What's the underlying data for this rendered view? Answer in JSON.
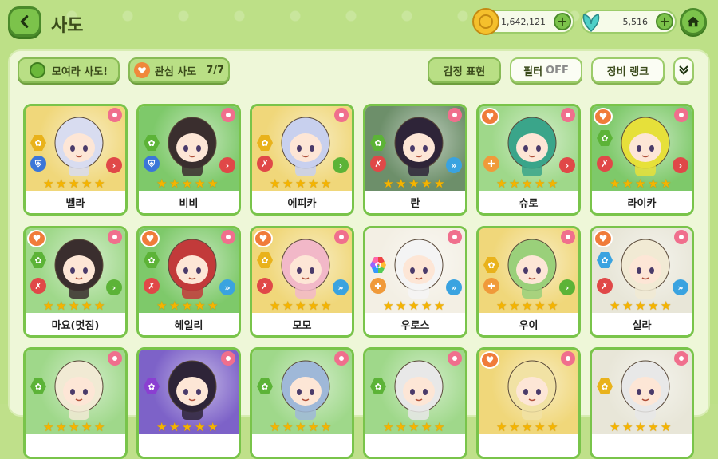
{
  "header": {
    "title": "사도",
    "currency_gold": "1,642,121",
    "currency_leaf": "5,516"
  },
  "toolbar": {
    "gather_label": "모여라 사도!",
    "favorite_label": "관심 사도",
    "favorite_count": "7/7",
    "emote_label": "감정 표현",
    "filter_label": "필터",
    "filter_state": "OFF",
    "rank_label": "장비 랭크"
  },
  "colors": {
    "accent_green": "#79c44a",
    "background": "#bde087",
    "star": "#f5b400",
    "fav_heart": "#f07c3a",
    "flower": "#f06f8d"
  },
  "characters": [
    {
      "name": "벨라",
      "stars": 5,
      "favorite": false,
      "element": "yellow",
      "class": "shield",
      "bg": "#f0d77a",
      "hair": "#d8dcf0",
      "arrow": "red"
    },
    {
      "name": "비비",
      "stars": 5,
      "favorite": false,
      "element": "green",
      "class": "shield",
      "bg": "#7ec96a",
      "hair": "#3a2e2e",
      "arrow": "red"
    },
    {
      "name": "에피카",
      "stars": 5,
      "favorite": false,
      "element": "yellow",
      "class": "sword",
      "bg": "#f0d77a",
      "hair": "#c8d0ee",
      "arrow": "green"
    },
    {
      "name": "란",
      "stars": 5,
      "favorite": false,
      "element": "green",
      "class": "sword",
      "bg": "#6d8f6a",
      "hair": "#2e2438",
      "arrow": "sky"
    },
    {
      "name": "슈로",
      "stars": 5,
      "favorite": true,
      "element": "",
      "class": "cross",
      "bg": "#9fd88a",
      "hair": "#3aa58a",
      "arrow": "red"
    },
    {
      "name": "라이카",
      "stars": 5,
      "favorite": true,
      "element": "green",
      "class": "sword",
      "bg": "#7ec96a",
      "hair": "#e6e03a",
      "arrow": "red"
    },
    {
      "name": "마요(멋짐)",
      "stars": 5,
      "favorite": true,
      "element": "green",
      "class": "sword",
      "bg": "#9fd88a",
      "hair": "#3a2e2e",
      "arrow": "green"
    },
    {
      "name": "헤일리",
      "stars": 5,
      "favorite": true,
      "element": "green",
      "class": "sword",
      "bg": "#7ec96a",
      "hair": "#c23a3a",
      "arrow": "sky"
    },
    {
      "name": "모모",
      "stars": 5,
      "favorite": true,
      "element": "yellow",
      "class": "sword",
      "bg": "#f0d77a",
      "hair": "#f2b8c8",
      "arrow": "sky"
    },
    {
      "name": "우로스",
      "stars": 5,
      "favorite": false,
      "element": "rainbow",
      "class": "cross",
      "bg": "#f3efe4",
      "hair": "#f4f4f4",
      "arrow": "sky"
    },
    {
      "name": "우이",
      "stars": 5,
      "favorite": false,
      "element": "yellow",
      "class": "cross",
      "bg": "#f0d77a",
      "hair": "#9ad07a",
      "arrow": "green"
    },
    {
      "name": "실라",
      "stars": 5,
      "favorite": true,
      "element": "blue",
      "class": "sword",
      "bg": "#e8e6d8",
      "hair": "#f1ead4",
      "arrow": "sky"
    },
    {
      "name": "",
      "stars": 5,
      "favorite": false,
      "element": "green",
      "class": "",
      "bg": "#9fd88a",
      "hair": "#f1ead4",
      "arrow": ""
    },
    {
      "name": "",
      "stars": 5,
      "favorite": false,
      "element": "purple",
      "class": "",
      "bg": "#7d62c8",
      "hair": "#2e2438",
      "arrow": ""
    },
    {
      "name": "",
      "stars": 5,
      "favorite": false,
      "element": "green",
      "class": "",
      "bg": "#9fd88a",
      "hair": "#9fb8d8",
      "arrow": ""
    },
    {
      "name": "",
      "stars": 5,
      "favorite": false,
      "element": "green",
      "class": "",
      "bg": "#9fd88a",
      "hair": "#e8e8e8",
      "arrow": ""
    },
    {
      "name": "",
      "stars": 5,
      "favorite": true,
      "element": "",
      "class": "",
      "bg": "#f0d77a",
      "hair": "#f1e2a4",
      "arrow": ""
    },
    {
      "name": "",
      "stars": 5,
      "favorite": false,
      "element": "yellow",
      "class": "",
      "bg": "#e8e6d8",
      "hair": "#e8e8e8",
      "arrow": ""
    }
  ]
}
